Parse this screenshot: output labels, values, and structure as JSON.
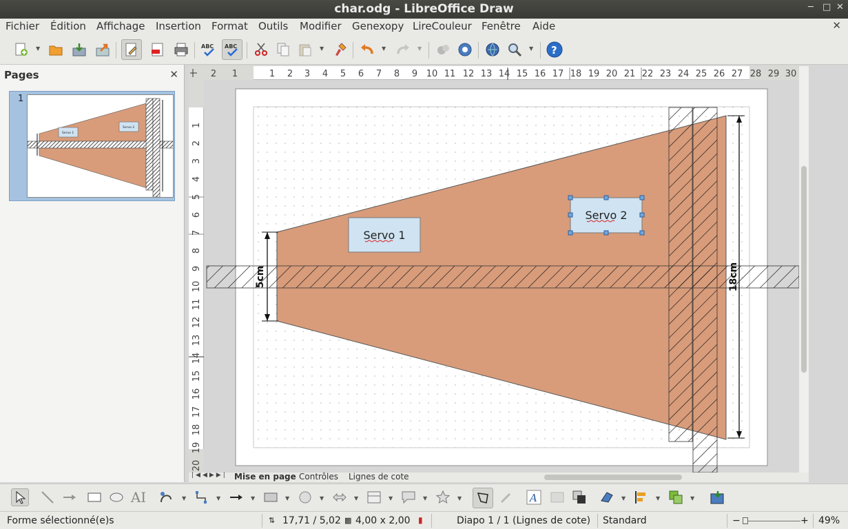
{
  "window": {
    "title": "char.odg - LibreOffice Draw"
  },
  "menu": {
    "items": [
      "Fichier",
      "Édition",
      "Affichage",
      "Insertion",
      "Format",
      "Outils",
      "Modifier",
      "Genexopy",
      "LireCouleur",
      "Fenêtre",
      "Aide"
    ]
  },
  "pages_panel": {
    "title": "Pages",
    "page_number": "1"
  },
  "ruler": {
    "h_labels": [
      "2",
      "1",
      "1",
      "2",
      "3",
      "4",
      "5",
      "6",
      "7",
      "8",
      "9",
      "10",
      "11",
      "12",
      "13",
      "14",
      "15",
      "16",
      "17",
      "18",
      "19",
      "20",
      "21",
      "22",
      "23",
      "24",
      "25",
      "26",
      "27",
      "28",
      "29",
      "30"
    ],
    "v_labels": [
      "1",
      "2",
      "3",
      "4",
      "5",
      "6",
      "7",
      "8",
      "9",
      "10",
      "11",
      "12",
      "13",
      "14",
      "15",
      "16",
      "17",
      "18",
      "19",
      "20"
    ]
  },
  "drawing": {
    "servo1": "Servo 1",
    "servo2": "Servo 2",
    "dim_left": "5cm",
    "dim_right": "18cm",
    "thumb_servo1": "Servo 1",
    "thumb_servo2": "Servo 2",
    "fill_color": "#d89c7b"
  },
  "tabs": [
    "Mise en page",
    "Contrôles",
    "Lignes de cote"
  ],
  "status": {
    "selection": "Forme sélectionné(e)s",
    "position": "17,71 / 5,02",
    "size": "4,00 x 2,00",
    "slide": "Diapo 1 / 1 (Lignes de cote)",
    "layout": "Standard",
    "zoom": "49%"
  },
  "icons": {
    "toolbar": [
      "new-icon",
      "open-icon",
      "save-icon",
      "export-icon",
      "edit-file-icon",
      "pdf-icon",
      "print-icon",
      "spellcheck-icon",
      "autospell-icon",
      "cut-icon",
      "copy-icon",
      "paste-icon",
      "clone-format-icon",
      "undo-icon",
      "redo-icon",
      "gallery-icon",
      "navigator-icon",
      "web-icon",
      "zoom-icon",
      "help-icon"
    ],
    "draw": [
      "select-icon",
      "line-icon",
      "arrow-line-icon",
      "rectangle-icon",
      "ellipse-icon",
      "text-icon",
      "curve-icon",
      "connector-icon",
      "lines-arrows-icon",
      "basic-shapes-icon",
      "symbol-shapes-icon",
      "block-arrows-icon",
      "flowchart-icon",
      "callouts-icon",
      "stars-icon",
      "points-icon",
      "glue-points-icon",
      "fontwork-icon",
      "from-file-icon",
      "extrusion-icon",
      "transform-icon",
      "align-icon",
      "arrange-icon",
      "insert-object-icon"
    ]
  }
}
